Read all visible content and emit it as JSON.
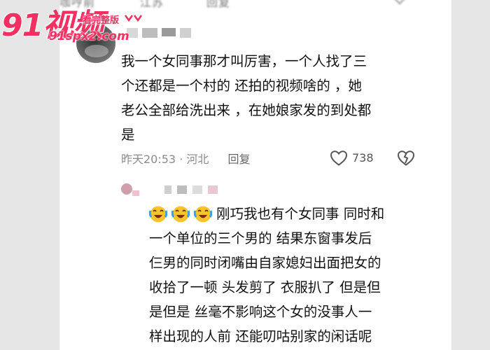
{
  "header": {
    "faded_text_1": "咖哼前",
    "faded_text_2": "江苏",
    "faded_text_3": "回复"
  },
  "comment_1": {
    "lines": [
      "我一个女同事那才叫厉害，一个人找了三",
      "个还都是一个村的  还拍的视频啥的  ，她",
      "老公全部给洗出来  ，在她娘家发的到处都",
      "是"
    ],
    "time": "昨天20:53 · 河北",
    "reply_label": "回复",
    "like_count": "738",
    "icons": [
      "heart-icon",
      "dislike-heart-icon"
    ]
  },
  "comment_2": {
    "emoji_names": [
      "crying-laughing-emoji",
      "crying-laughing-emoji",
      "crying-laughing-emoji"
    ],
    "lines": [
      "刚巧我也有个女同事 同时和",
      "一个单位的三个男的 结果东窗事发后",
      "仨男的同时闭嘴由自家媳妇出面把女的",
      "收拾了一顿 头发剪了 衣服扒了 但是但",
      "是但是 丝毫不影响这个女的没事人一",
      "样出现的人前 还能叨咕别家的闲话呢"
    ]
  },
  "watermark": {
    "logo": "91视频",
    "tagline": "看完整版",
    "url": "91spx2.com",
    "color": "#f03060"
  }
}
